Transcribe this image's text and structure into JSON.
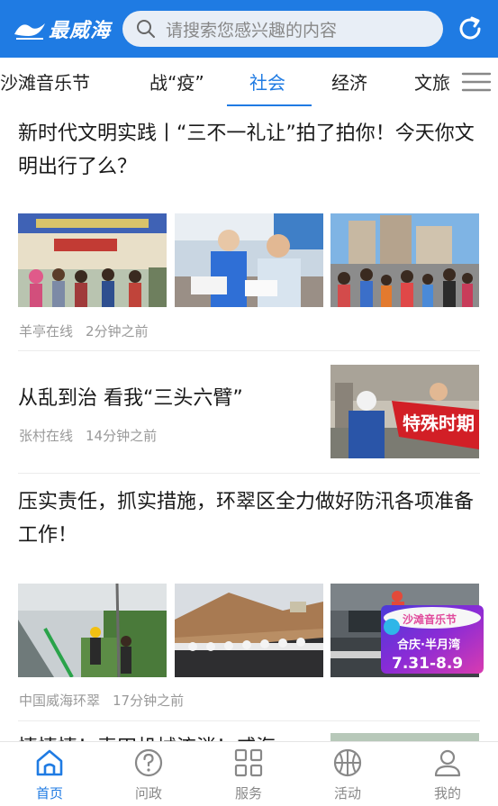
{
  "header": {
    "logo_text": "最威海",
    "search_placeholder": "请搜索您感兴趣的内容"
  },
  "tabs": [
    {
      "label": "沙滩音乐节"
    },
    {
      "label": "战“疫”"
    },
    {
      "label": "社会",
      "active": true
    },
    {
      "label": "经济"
    },
    {
      "label": "文旅"
    }
  ],
  "articles": [
    {
      "title": "新时代文明实践丨“三不一礼让”拍了拍你！今天你文明出行了么？",
      "source": "羊亭在线",
      "time": "2分钟之前"
    },
    {
      "title": "从乱到治 看我“三头六臂”",
      "source": "张村在线",
      "time": "14分钟之前",
      "thumb_banner": "特殊时期"
    },
    {
      "title": "压实责任，抓实措施，环翠区全力做好防汛各项准备工作！",
      "source": "中国威海环翠",
      "time": "17分钟之前"
    },
    {
      "title": "情情情！麦田机械流淌！威海"
    }
  ],
  "promo_badge": {
    "title": "沙滩音乐节",
    "location": "合庆·半月湾",
    "dates": "7.31-8.9"
  },
  "bottom_nav": [
    {
      "label": "首页",
      "icon": "home-icon",
      "active": true
    },
    {
      "label": "问政",
      "icon": "question-icon"
    },
    {
      "label": "服务",
      "icon": "grid-icon"
    },
    {
      "label": "活动",
      "icon": "basketball-icon"
    },
    {
      "label": "我的",
      "icon": "user-icon"
    }
  ],
  "colors": {
    "accent": "#1f7be3",
    "meta_text": "#999999",
    "nav_inactive": "#888888"
  }
}
